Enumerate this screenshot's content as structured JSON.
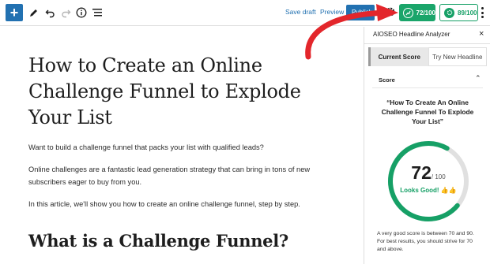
{
  "toolbar": {
    "add_label": "+",
    "save_draft": "Save draft",
    "preview": "Preview",
    "publish": "Publish",
    "headline_score": "72/100",
    "seo_score": "89/100"
  },
  "editor": {
    "title": "How to Create an Online Challenge Funnel to Explode Your List",
    "paragraphs": [
      "Want to build a challenge funnel that packs your list with qualified leads?",
      "Online challenges are a fantastic lead generation strategy that can bring in tons of new subscribers eager to buy from you.",
      "In this article, we'll show you how to create an online challenge funnel, step by step."
    ],
    "heading2": "What is a Challenge Funnel?"
  },
  "sidebar": {
    "title": "AIOSEO Headline Analyzer",
    "close": "×",
    "tabs": [
      {
        "label": "Current Score",
        "active": true
      },
      {
        "label": "Try New Headline",
        "active": false
      }
    ],
    "section_title": "Score",
    "section_toggle": "⌃",
    "headline": "“How To Create An Online Challenge Funnel To Explode Your List”",
    "score": {
      "value": "72",
      "max": "/ 100",
      "fraction": 0.72,
      "label": "Looks Good!",
      "emoji": "👍👍"
    },
    "note": "A very good score is between 70 and 90. For best results, you should strive for 70 and above."
  },
  "colors": {
    "primary_blue": "#2271b1",
    "score_green": "#16a066",
    "arrow_red": "#e3262b",
    "gauge_track": "#e0e0e0"
  },
  "icons": [
    "plus-icon",
    "pencil-icon",
    "undo-icon",
    "redo-icon",
    "info-icon",
    "list-view-icon",
    "gear-icon",
    "headline-score-icon",
    "seo-score-icon",
    "close-icon",
    "chevron-up-icon",
    "red-arrow-annotation"
  ]
}
